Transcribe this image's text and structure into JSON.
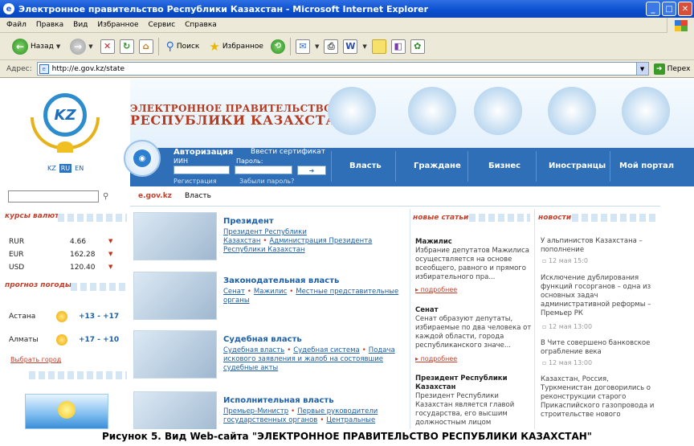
{
  "window": {
    "title": "Электронное правительство Республики Казахстан - Microsoft Internet Explorer",
    "menu": [
      "Файл",
      "Правка",
      "Вид",
      "Избранное",
      "Сервис",
      "Справка"
    ]
  },
  "toolbar": {
    "back": "Назад",
    "search": "Поиск",
    "favorites": "Избранное"
  },
  "address": {
    "label": "Адрес:",
    "url": "http://e.gov.kz/state",
    "go": "Перех"
  },
  "site": {
    "title_line1": "ЭЛЕКТРОННОЕ ПРАВИТЕЛЬСТВО",
    "title_line2": "РЕСПУБЛИКИ КАЗАХСТАН",
    "langs": [
      "KZ",
      "RU",
      "EN"
    ],
    "auth": {
      "title": "Авторизация",
      "cert": "Ввести сертификат",
      "iin": "ИИН",
      "password": "Пароль:",
      "register": "Регистрация",
      "forgot": "Забыли пароль?"
    },
    "nav": [
      "Власть",
      "Граждане",
      "Бизнес",
      "Иностранцы",
      "Мой портал"
    ],
    "breadcrumb": {
      "site": "e.gov.kz",
      "current": "Власть"
    }
  },
  "left": {
    "currency_head": "курсы валют",
    "currencies": [
      {
        "code": "RUR",
        "value": "4.66"
      },
      {
        "code": "EUR",
        "value": "162.28"
      },
      {
        "code": "USD",
        "value": "120.40"
      }
    ],
    "weather_head": "прогноз погоды",
    "weather": [
      {
        "city": "Астана",
        "temp": "+13 - +17"
      },
      {
        "city": "Алматы",
        "temp": "+17 - +10"
      }
    ],
    "choose_city": "Выбрать город"
  },
  "blocks": [
    {
      "title": "Президент",
      "links": [
        "Президент Республики Казахстан",
        "Администрация Президента Республики Казахстан"
      ]
    },
    {
      "title": "Законодательная власть",
      "links": [
        "Сенат",
        "Мажилис",
        "Местные представительные органы"
      ]
    },
    {
      "title": "Судебная власть",
      "links": [
        "Судебная власть",
        "Судебная система",
        "Подача искового заявления и жалоб на состоявшие судебные акты"
      ]
    },
    {
      "title": "Исполнительная власть",
      "links": [
        "Премьер-Министр",
        "Первые руководители государственных органов",
        "Центральные"
      ]
    }
  ],
  "articles": {
    "head": "новые статьи",
    "more": "подробнее",
    "items": [
      {
        "title": "Мажилис",
        "text": "Избрание депутатов Мажилиса осуществляется на основе всеобщего, равного и прямого избирательного пра..."
      },
      {
        "title": "Сенат",
        "text": "Сенат образуют депутаты, избираемые по два человека от каждой области, города республиканского значе..."
      },
      {
        "title": "Президент Республики Казахстан",
        "text": "Президент Республики Казахстан является главой государства, его высшим должностным лицом"
      }
    ]
  },
  "news": {
    "head": "новости",
    "items": [
      {
        "text": "У альпинистов Казахстана – пополнение",
        "date": "12 мая 15:0"
      },
      {
        "text": "Исключение дублирования функций госорганов – одна из основных задач административной реформы – Премьер РК",
        "date": "12 мая 13:00"
      },
      {
        "text": "В Чите совершено банковское ограбление века",
        "date": "12 мая 13:00"
      },
      {
        "text": "Казахстан, Россия, Туркменистан договорились о реконструкции старого Прикаспийского газопровода и строительстве нового",
        "date": ""
      }
    ]
  },
  "caption": "Рисунок 5.  Вид Web-сайта \"ЭЛЕКТРОННОЕ ПРАВИТЕЛЬСТВО РЕСПУБЛИКИ КАЗАХСТАН\""
}
